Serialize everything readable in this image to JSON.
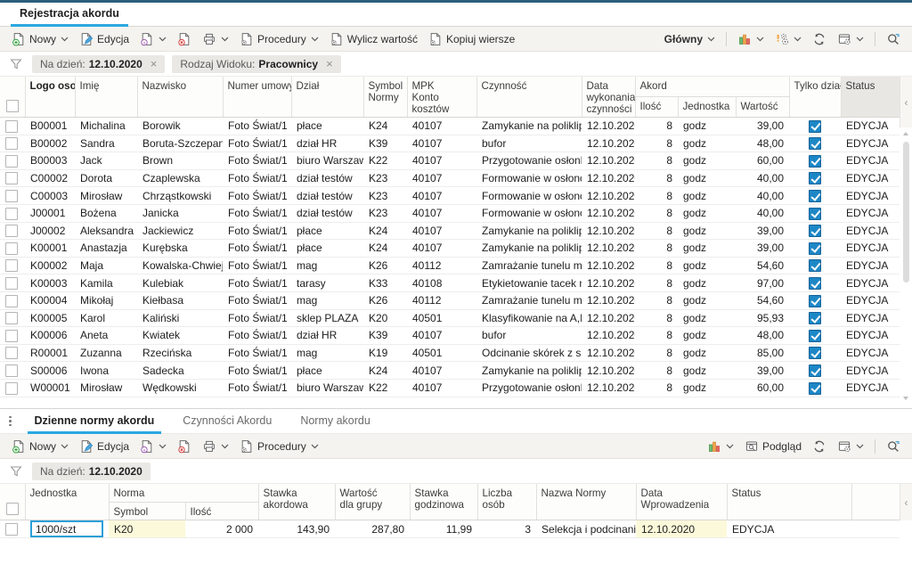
{
  "header": {
    "tab": "Rejestracja akordu"
  },
  "glyphs": {
    "close": "×",
    "collapse": "‹"
  },
  "colors": {
    "accent": "#2ba7e0",
    "topbar": "#2d607e",
    "checkbox_checked": "#1d87c6",
    "cell_highlight": "#fbf9da",
    "status_header_bg": "#e9e7e3"
  },
  "toolbar_main": {
    "new": "Nowy",
    "edit": "Edycja",
    "procedures": "Procedury",
    "calc_value": "Wylicz wartość",
    "copy_rows": "Kopiuj wiersze",
    "view": "Główny"
  },
  "filters_main": [
    {
      "label": "Na dzień:",
      "value": "12.10.2020"
    },
    {
      "label": "Rodzaj Widoku:",
      "value": "Pracownicy"
    }
  ],
  "grid_main": {
    "columns": {
      "logo": "Logo osoby",
      "imie": "Imię",
      "nazwisko": "Nazwisko",
      "umowa": "Numer umowy",
      "dzial": "Dział",
      "symbol": "Symbol\nNormy",
      "mpk": "MPK\nKonto kosztów",
      "czynnosc": "Czynność",
      "data": "Data\nwykonania\nczynności",
      "akord": "Akord",
      "ilosc": "Ilość",
      "jednostka": "Jednostka",
      "wartosc": "Wartość",
      "tylko": "Tylko dział",
      "status": "Status"
    },
    "rows": [
      {
        "logo": "B00001",
        "imie": "Michalina",
        "nazwisko": "Borowik",
        "umowa": "Foto Świat/1",
        "dzial": "płace",
        "symbol": "K24",
        "mpk": "40107",
        "czynnosc": "Zamykanie na poliklipac",
        "data": "12.10.2020",
        "ilosc": "8",
        "jednostka": "godz",
        "wartosc": "39,00",
        "tylko": true,
        "status": "EDYCJA"
      },
      {
        "logo": "B00002",
        "imie": "Sandra",
        "nazwisko": "Boruta-Szczepaniak",
        "umowa": "Foto Świat/1",
        "dzial": "dział HR",
        "symbol": "K39",
        "mpk": "40107",
        "czynnosc": "bufor",
        "data": "12.10.2020",
        "ilosc": "8",
        "jednostka": "godz",
        "wartosc": "48,00",
        "tylko": true,
        "status": "EDYCJA"
      },
      {
        "logo": "B00003",
        "imie": "Jack",
        "nazwisko": "Brown",
        "umowa": "Foto Świat/1",
        "dzial": "biuro Warszawa",
        "symbol": "K22",
        "mpk": "40107",
        "czynnosc": "Przygotowanie osłonki",
        "data": "12.10.2020",
        "ilosc": "8",
        "jednostka": "godz",
        "wartosc": "60,00",
        "tylko": true,
        "status": "EDYCJA"
      },
      {
        "logo": "C00002",
        "imie": "Dorota",
        "nazwisko": "Czaplewska",
        "umowa": "Foto Świat/1",
        "dzial": "dział testów",
        "symbol": "K23",
        "mpk": "40107",
        "czynnosc": "Formowanie w osłonce",
        "data": "12.10.2020",
        "ilosc": "8",
        "jednostka": "godz",
        "wartosc": "40,00",
        "tylko": true,
        "status": "EDYCJA"
      },
      {
        "logo": "C00003",
        "imie": "Mirosław",
        "nazwisko": "Chrząstkowski",
        "umowa": "Foto Świat/1",
        "dzial": "dział testów",
        "symbol": "K23",
        "mpk": "40107",
        "czynnosc": "Formowanie w osłonce",
        "data": "12.10.2020",
        "ilosc": "8",
        "jednostka": "godz",
        "wartosc": "40,00",
        "tylko": true,
        "status": "EDYCJA"
      },
      {
        "logo": "J00001",
        "imie": "Bożena",
        "nazwisko": "Janicka",
        "umowa": "Foto Świat/1",
        "dzial": "dział testów",
        "symbol": "K23",
        "mpk": "40107",
        "czynnosc": "Formowanie w osłonce",
        "data": "12.10.2020",
        "ilosc": "8",
        "jednostka": "godz",
        "wartosc": "40,00",
        "tylko": true,
        "status": "EDYCJA"
      },
      {
        "logo": "J00002",
        "imie": "Aleksandra",
        "nazwisko": "Jackiewicz",
        "umowa": "Foto Świat/1",
        "dzial": "płace",
        "symbol": "K24",
        "mpk": "40107",
        "czynnosc": "Zamykanie na poliklipac",
        "data": "12.10.2020",
        "ilosc": "8",
        "jednostka": "godz",
        "wartosc": "39,00",
        "tylko": true,
        "status": "EDYCJA"
      },
      {
        "logo": "K00001",
        "imie": "Anastazja",
        "nazwisko": "Kurębska",
        "umowa": "Foto Świat/1",
        "dzial": "płace",
        "symbol": "K24",
        "mpk": "40107",
        "czynnosc": "Zamykanie na poliklipac",
        "data": "12.10.2020",
        "ilosc": "8",
        "jednostka": "godz",
        "wartosc": "39,00",
        "tylko": true,
        "status": "EDYCJA"
      },
      {
        "logo": "K00002",
        "imie": "Maja",
        "nazwisko": "Kowalska-Chwieju",
        "umowa": "Foto Świat/1",
        "dzial": "mag",
        "symbol": "K26",
        "mpk": "40112",
        "czynnosc": "Zamrażanie tunelu mroźn",
        "data": "12.10.2020",
        "ilosc": "8",
        "jednostka": "godz",
        "wartosc": "54,60",
        "tylko": true,
        "status": "EDYCJA"
      },
      {
        "logo": "K00003",
        "imie": "Kamila",
        "nazwisko": "Kulebiak",
        "umowa": "Foto Świat/1",
        "dzial": "tarasy",
        "symbol": "K33",
        "mpk": "40108",
        "czynnosc": "Etykietowanie tacek na",
        "data": "12.10.2020",
        "ilosc": "8",
        "jednostka": "godz",
        "wartosc": "97,00",
        "tylko": true,
        "status": "EDYCJA"
      },
      {
        "logo": "K00004",
        "imie": "Mikołaj",
        "nazwisko": "Kiełbasa",
        "umowa": "Foto Świat/1",
        "dzial": "mag",
        "symbol": "K26",
        "mpk": "40112",
        "czynnosc": "Zamrażanie tunelu mroźn",
        "data": "12.10.2020",
        "ilosc": "8",
        "jednostka": "godz",
        "wartosc": "54,60",
        "tylko": true,
        "status": "EDYCJA"
      },
      {
        "logo": "K00005",
        "imie": "Karol",
        "nazwisko": "Kaliński",
        "umowa": "Foto Świat/1",
        "dzial": "sklep PLAZA",
        "symbol": "K20",
        "mpk": "40501",
        "czynnosc": "Klasyfikowanie na A,B,C",
        "data": "12.10.2020",
        "ilosc": "8",
        "jednostka": "godz",
        "wartosc": "95,93",
        "tylko": true,
        "status": "EDYCJA"
      },
      {
        "logo": "K00006",
        "imie": "Aneta",
        "nazwisko": "Kwiatek",
        "umowa": "Foto Świat/1",
        "dzial": "dział HR",
        "symbol": "K39",
        "mpk": "40107",
        "czynnosc": "bufor",
        "data": "12.10.2020",
        "ilosc": "8",
        "jednostka": "godz",
        "wartosc": "48,00",
        "tylko": true,
        "status": "EDYCJA"
      },
      {
        "logo": "R00001",
        "imie": "Zuzanna",
        "nazwisko": "Rzecińska",
        "umowa": "Foto Świat/1",
        "dzial": "mag",
        "symbol": "K19",
        "mpk": "40501",
        "czynnosc": "Odcinanie skórek z szyi",
        "data": "12.10.2020",
        "ilosc": "8",
        "jednostka": "godz",
        "wartosc": "85,00",
        "tylko": true,
        "status": "EDYCJA"
      },
      {
        "logo": "S00006",
        "imie": "Iwona",
        "nazwisko": "Sadecka",
        "umowa": "Foto Świat/1",
        "dzial": "płace",
        "symbol": "K24",
        "mpk": "40107",
        "czynnosc": "Zamykanie na poliklipac",
        "data": "12.10.2020",
        "ilosc": "8",
        "jednostka": "godz",
        "wartosc": "39,00",
        "tylko": true,
        "status": "EDYCJA"
      },
      {
        "logo": "W00001",
        "imie": "Mirosław",
        "nazwisko": "Wędkowski",
        "umowa": "Foto Świat/1",
        "dzial": "biuro Warszawa",
        "symbol": "K22",
        "mpk": "40107",
        "czynnosc": "Przygotowanie osłonki",
        "data": "12.10.2020",
        "ilosc": "8",
        "jednostka": "godz",
        "wartosc": "60,00",
        "tylko": true,
        "status": "EDYCJA"
      }
    ]
  },
  "detail_tabs": [
    {
      "label": "Dzienne normy akordu",
      "active": true
    },
    {
      "label": "Czynności Akordu",
      "active": false
    },
    {
      "label": "Normy akordu",
      "active": false
    }
  ],
  "toolbar_detail": {
    "new": "Nowy",
    "edit": "Edycja",
    "procedures": "Procedury",
    "preview": "Podgląd"
  },
  "filters_detail": [
    {
      "label": "Na dzień:",
      "value": "12.10.2020"
    }
  ],
  "grid_detail": {
    "columns": {
      "jednostka": "Jednostka",
      "norma": "Norma",
      "symbol": "Symbol",
      "ilosc": "Ilość",
      "stawka_akordowa": "Stawka\nakordowa",
      "wartosc_dla_grupy": "Wartość\ndla grupy",
      "stawka_godzinowa": "Stawka\ngodzinowa",
      "liczba_osob": "Liczba\nosób",
      "nazwa_normy": "Nazwa Normy",
      "data_wprowadzenia": "Data\nWprowadzenia",
      "status": "Status"
    },
    "rows": [
      {
        "jednostka": "1000/szt",
        "symbol": "K20",
        "ilosc": "2 000",
        "stawka_akordowa": "143,90",
        "wartosc_dla_grupy": "287,80",
        "stawka_godzinowa": "11,99",
        "liczba_osob": "3",
        "nazwa_normy": "Selekcja i podcinanie",
        "data_wprowadzenia": "12.10.2020",
        "status": "EDYCJA"
      }
    ]
  }
}
